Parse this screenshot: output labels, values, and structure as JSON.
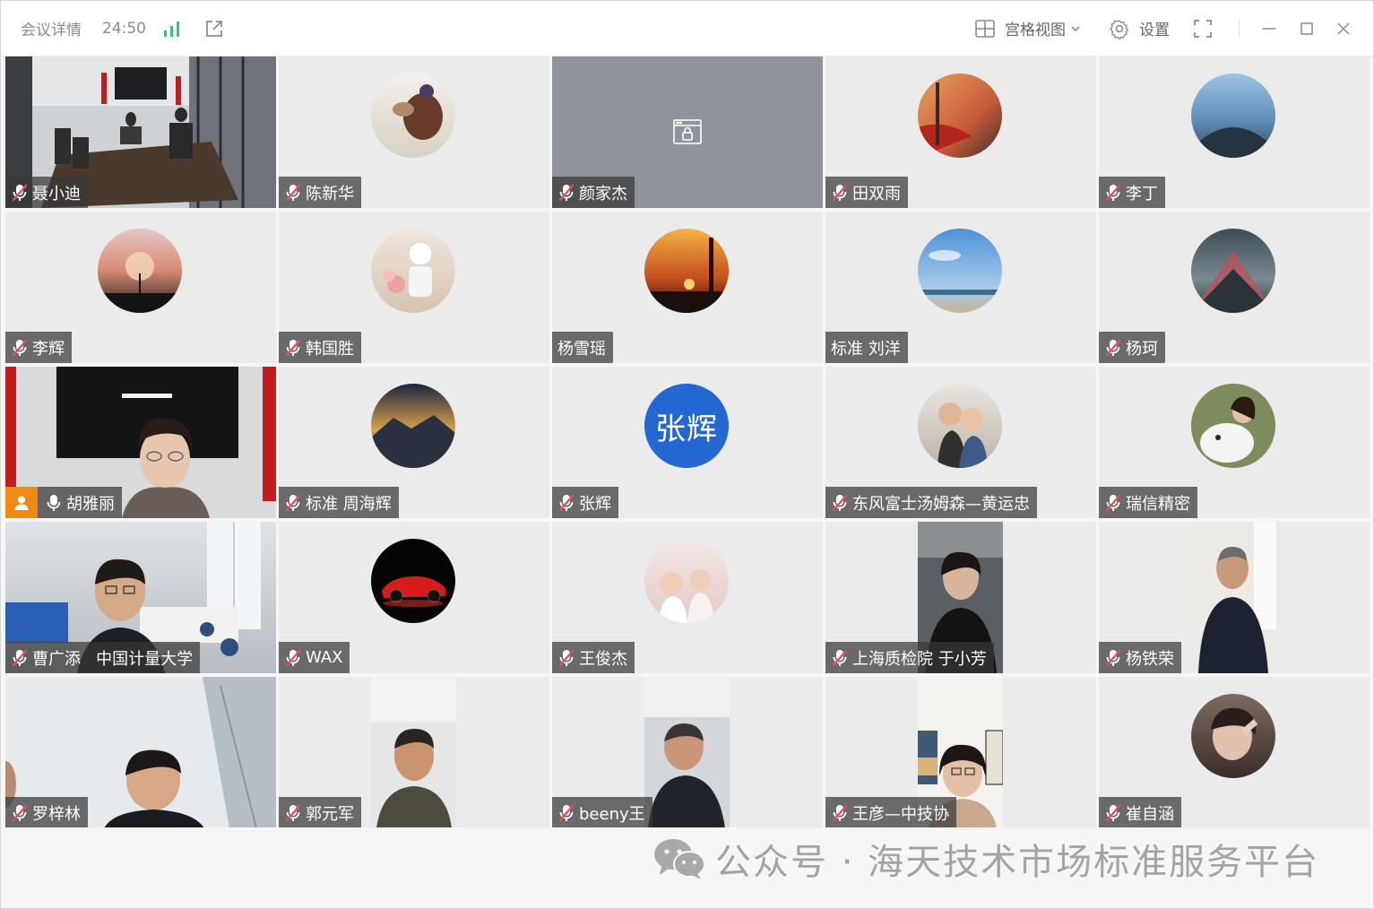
{
  "titlebar": {
    "meeting_details": "会议详情",
    "elapsed_time": "24:50",
    "view_mode": "宫格视图",
    "settings": "设置"
  },
  "colors": {
    "host_badge": "#f08a14",
    "text_avatar": "#2367d3",
    "signal": "#33c28a",
    "muted_mic": "#e2505a"
  },
  "participants": [
    {
      "name": "聂小迪",
      "muted": true,
      "media": "video"
    },
    {
      "name": "陈新华",
      "muted": true,
      "media": "avatar"
    },
    {
      "name": "颜家杰",
      "muted": true,
      "media": "locked"
    },
    {
      "name": "田双雨",
      "muted": true,
      "media": "avatar"
    },
    {
      "name": "李丁",
      "muted": true,
      "media": "avatar"
    },
    {
      "name": "李辉",
      "muted": true,
      "media": "avatar"
    },
    {
      "name": "韩国胜",
      "muted": true,
      "media": "avatar"
    },
    {
      "name": "杨雪瑶",
      "muted": false,
      "media": "avatar"
    },
    {
      "name": "标准 刘洋",
      "muted": false,
      "media": "avatar"
    },
    {
      "name": "杨珂",
      "muted": true,
      "media": "avatar"
    },
    {
      "name": "胡雅丽",
      "muted": false,
      "host": true,
      "media": "video"
    },
    {
      "name": "标准  周海辉",
      "muted": true,
      "media": "avatar"
    },
    {
      "name": "张辉",
      "muted": true,
      "media": "text-avatar",
      "avatar_text": "张辉"
    },
    {
      "name": "东风富士汤姆森—黄运忠",
      "muted": true,
      "media": "avatar"
    },
    {
      "name": "瑞信精密",
      "muted": true,
      "media": "avatar"
    },
    {
      "name": "曹广添   中国计量大学",
      "muted": true,
      "media": "video"
    },
    {
      "name": "WAX",
      "muted": true,
      "media": "avatar"
    },
    {
      "name": "王俊杰",
      "muted": true,
      "media": "avatar"
    },
    {
      "name": "上海质检院 于小芳",
      "muted": true,
      "media": "portrait"
    },
    {
      "name": "杨铁荣",
      "muted": true,
      "media": "portrait"
    },
    {
      "name": "罗梓林",
      "muted": true,
      "media": "video"
    },
    {
      "name": "郭元军",
      "muted": true,
      "media": "portrait"
    },
    {
      "name": "beeny王",
      "muted": true,
      "media": "portrait"
    },
    {
      "name": "王彦—中技协",
      "muted": true,
      "media": "portrait"
    },
    {
      "name": "崔自涵",
      "muted": true,
      "media": "avatar"
    }
  ],
  "watermark": "公众号 · 海天技术市场标准服务平台"
}
